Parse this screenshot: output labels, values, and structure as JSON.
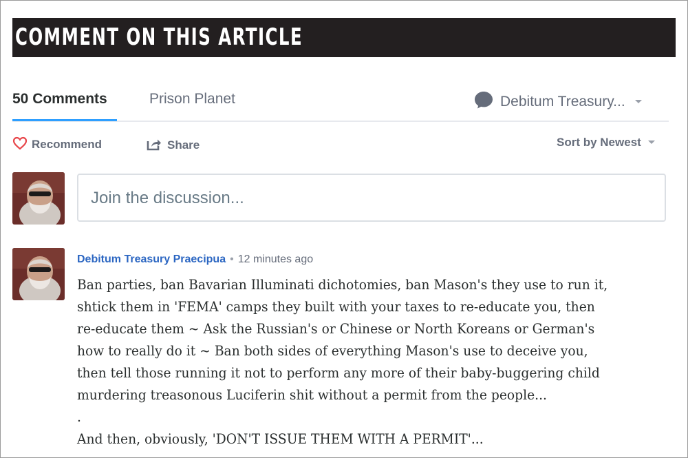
{
  "banner": {
    "title": "COMMENT ON THIS ARTICLE"
  },
  "nav": {
    "comments_tab": "50 Comments",
    "site_tab": "Prison Planet",
    "user_menu": "Debitum Treasury..."
  },
  "actions": {
    "recommend_label": "Recommend",
    "share_label": "Share",
    "sort_label": "Sort by Newest"
  },
  "composer": {
    "placeholder": "Join the discussion..."
  },
  "comment": {
    "author": "Debitum Treasury Praecipua",
    "separator": "•",
    "time": "12 minutes ago",
    "lines": [
      "Ban parties, ban Bavarian Illuminati dichotomies, ban Mason's they use to run it,",
      "shtick them in 'FEMA' camps they built with your taxes to re-educate you, then",
      "re-educate them ~ Ask the Russian's or Chinese or North Koreans or German's",
      "how to really do it ~ Ban both sides of everything Mason's use to deceive you,",
      "then tell those running it not to perform any more of their baby-buggering child",
      "murdering treasonous Luciferin shit without a permit from the people...",
      ".",
      "And then, obviously, 'DON'T ISSUE THEM WITH A PERMIT'..."
    ]
  },
  "colors": {
    "banner_bg": "#231f20",
    "accent_blue": "#2e9fff",
    "author_link": "#2b66c2",
    "heart_red": "#e8464a"
  },
  "icons": {
    "user_menu": "chat-bubble-icon",
    "recommend": "heart-icon",
    "share": "share-icon",
    "dropdown": "caret-down-icon"
  }
}
